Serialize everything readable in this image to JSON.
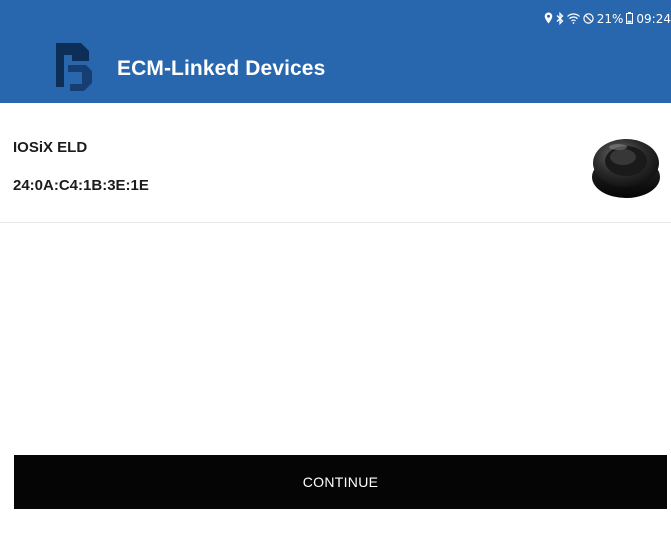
{
  "status_bar": {
    "icons": [
      "location-icon",
      "bluetooth-icon",
      "wifi-icon",
      "do-not-disturb-icon",
      "battery-icon"
    ],
    "battery_percent": "21%",
    "time": "09:24"
  },
  "app_bar": {
    "title": "ECM-Linked Devices",
    "background": "#2867ad"
  },
  "devices": [
    {
      "name": "IOSiX ELD",
      "mac": "24:0A:C4:1B:3E:1E",
      "icon": "eld-device-puck"
    }
  ],
  "continue_button": {
    "label": "CONTINUE",
    "background": "#050505"
  }
}
